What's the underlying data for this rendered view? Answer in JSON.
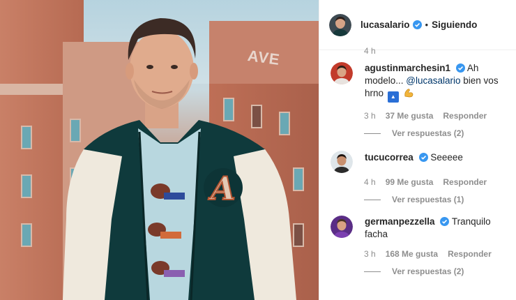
{
  "post": {
    "username": "lucasalario",
    "follow_status": "Siguiendo",
    "separator": "•"
  },
  "photo": {
    "building_sign": "AVE"
  },
  "truncated_time": "4 h",
  "comments": [
    {
      "username": "agustinmarchesin1",
      "text_before": "Ah modelo... ",
      "mention": "@lucasalario",
      "text_after": " bien vos hrno",
      "emoji_1": "flag-icon",
      "emoji_2": "flexed-biceps-icon",
      "time": "3 h",
      "likes": "37 Me gusta",
      "reply": "Responder",
      "view_replies": "Ver respuestas (2)"
    },
    {
      "username": "tucucorrea",
      "text": "Seeeee",
      "time": "4 h",
      "likes": "99 Me gusta",
      "reply": "Responder",
      "view_replies": "Ver respuestas (1)"
    },
    {
      "username": "germanpezzella",
      "text": "Tranquilo facha",
      "time": "3 h",
      "likes": "168 Me gusta",
      "reply": "Responder",
      "view_replies": "Ver respuestas (2)"
    }
  ],
  "colors": {
    "verified": "#3897f0",
    "text": "#262626",
    "muted": "#8e8e8e",
    "mention": "#00376b"
  }
}
